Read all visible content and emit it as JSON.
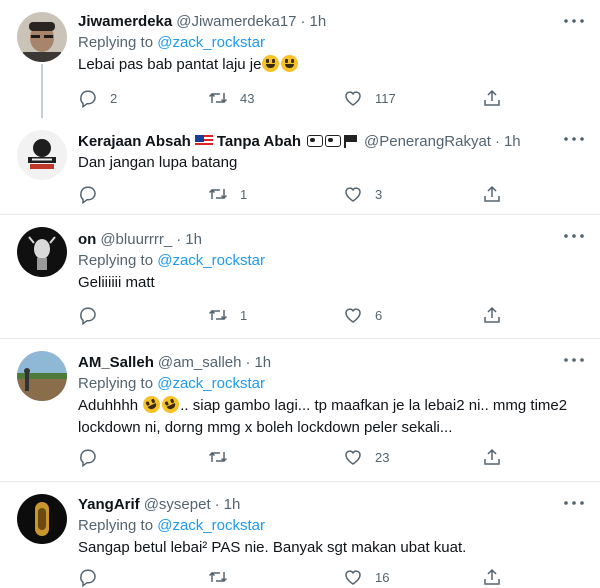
{
  "tweets": [
    {
      "name": "Jiwamerdeka",
      "handle": "@Jiwamerdeka17",
      "dot": "·",
      "time": "1h",
      "replying_prefix": "Replying to",
      "replying_to": "@zack_rockstar",
      "text": "Lebai pas  bab pantat laju je",
      "emoji": [
        "grinning-face",
        "grinning-face"
      ],
      "replies": "2",
      "retweets": "43",
      "likes": "117"
    },
    {
      "name": "Kerajaan Absah",
      "name_suffix": "Tanpa Abah",
      "badges": [
        "malaysia-flag",
        "cow",
        "black-flag"
      ],
      "handle": "@PenerangRakyat",
      "dot": "·",
      "time": "1h",
      "text": "Dan jangan lupa batang",
      "replies": "",
      "retweets": "1",
      "likes": "3"
    },
    {
      "name": "on",
      "handle": "@bluurrrr_",
      "dot": "·",
      "time": "1h",
      "replying_prefix": "Replying to",
      "replying_to": "@zack_rockstar",
      "text": "Geliiiiii matt",
      "replies": "",
      "retweets": "1",
      "likes": "6"
    },
    {
      "name": "AM_Salleh",
      "handle": "@am_salleh",
      "dot": "·",
      "time": "1h",
      "replying_prefix": "Replying to",
      "replying_to": "@zack_rockstar",
      "text_before_emoji": "Aduhhhh ",
      "emoji": [
        "rolling-on-floor-laughing",
        "rolling-on-floor-laughing"
      ],
      "text_after_emoji": ".. siap gambo lagi... tp maafkan je la lebai2 ni.. mmg time2",
      "text_line2": "lockdown ni, dorng mmg x boleh lockdown peler sekali...",
      "replies": "",
      "retweets": "",
      "likes": "23"
    },
    {
      "name": "YangArif",
      "handle": "@sysepet",
      "dot": "·",
      "time": "1h",
      "replying_prefix": "Replying to",
      "replying_to": "@zack_rockstar",
      "text": "Sangap betul lebai² PAS nie. Banyak sgt makan ubat kuat.",
      "replies": "",
      "retweets": "",
      "likes": "16"
    }
  ],
  "colors": {
    "text": "#0f1419",
    "secondary": "#536471",
    "link": "#1d9bf0",
    "divider": "#e6ecf0"
  },
  "icons": [
    "reply-icon",
    "retweet-icon",
    "like-icon",
    "share-icon",
    "more-icon"
  ]
}
